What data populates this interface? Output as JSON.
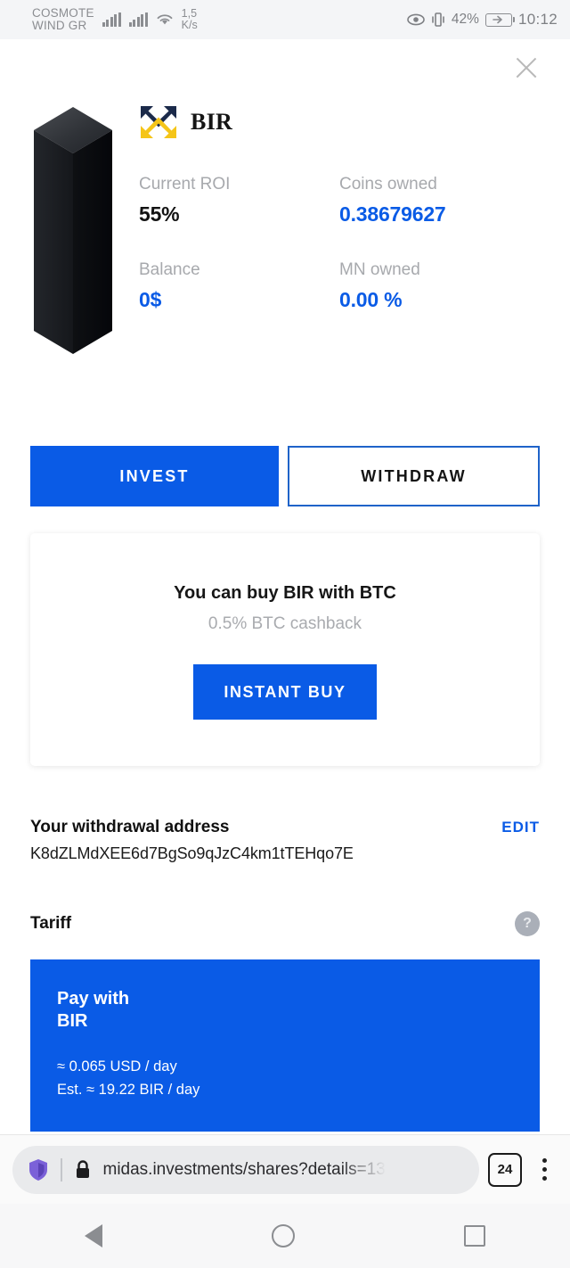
{
  "status_bar": {
    "carrier_line1": "COSMOTE",
    "carrier_line2": "WIND GR",
    "data_rate_value": "1,5",
    "data_rate_unit": "K/s",
    "battery_percent": "42%",
    "clock": "10:12",
    "icons": [
      "signal-bars-icon",
      "signal-bars-icon",
      "wifi-icon",
      "eye-icon",
      "vibrate-icon",
      "battery-charging-icon"
    ]
  },
  "header": {
    "close_label": "×",
    "asset_symbol": "BIR",
    "logo_icon": "bir-logo-icon",
    "artwork_icon": "masternode-monolith-icon"
  },
  "stats": [
    {
      "label": "Current ROI",
      "value": "55%",
      "color": "dark"
    },
    {
      "label": "Coins owned",
      "value": "0.38679627",
      "color": "blue"
    },
    {
      "label": "Balance",
      "value": "0$",
      "color": "blue"
    },
    {
      "label": "MN owned",
      "value": "0.00 %",
      "color": "blue"
    }
  ],
  "actions": {
    "invest_label": "INVEST",
    "withdraw_label": "WITHDRAW"
  },
  "buy_card": {
    "title": "You can buy BIR with BTC",
    "subtitle": "0.5% BTC cashback",
    "button_label": "INSTANT BUY"
  },
  "withdrawal": {
    "title": "Your withdrawal address",
    "edit_label": "EDIT",
    "address": "K8dZLMdXEE6d7BgSo9qJzC4km1tTEHqo7E"
  },
  "tariff": {
    "title": "Tariff",
    "help_label": "?",
    "pay_with_line1": "Pay with",
    "pay_with_line2": "BIR",
    "rate_usd": "≈ 0.065 USD / day",
    "rate_coin": "Est. ≈ 19.22 BIR / day"
  },
  "browser": {
    "url": "midas.investments/shares?details=13",
    "tab_count": "24",
    "shield_icon": "brave-shield-icon",
    "lock_icon": "lock-icon",
    "menu_icon": "kebab-menu-icon"
  },
  "navbar": {
    "back_icon": "back-triangle-icon",
    "home_icon": "home-circle-icon",
    "recents_icon": "recents-square-icon"
  },
  "colors": {
    "accent_blue": "#0A5BE6",
    "logo_gold": "#F5C518",
    "logo_navy": "#1B2A4A",
    "muted_gray": "#a7a9ad"
  }
}
